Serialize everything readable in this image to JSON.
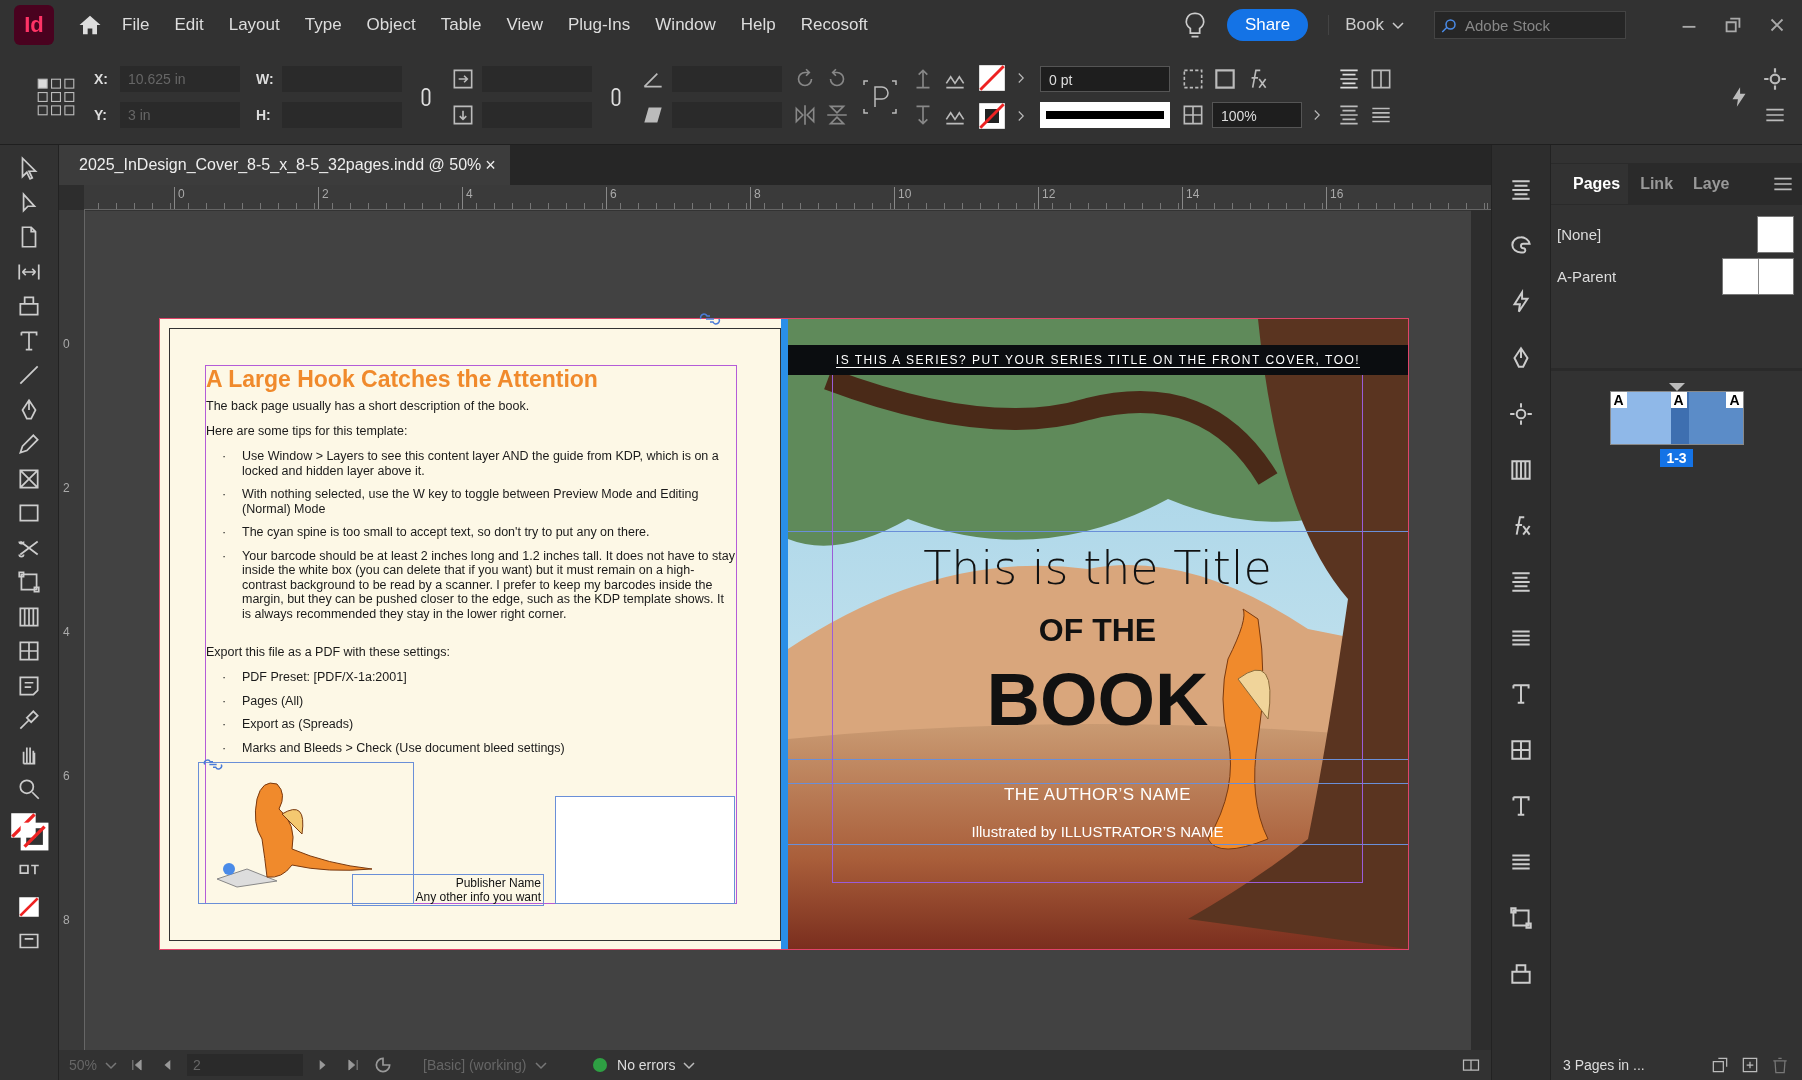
{
  "app": {
    "logo": "Id",
    "menus": [
      "File",
      "Edit",
      "Layout",
      "Type",
      "Object",
      "Table",
      "View",
      "Plug-Ins",
      "Window",
      "Help",
      "Recosoft"
    ],
    "share": "Share",
    "workspace": "Book",
    "stock_search": {
      "placeholder": "Adobe Stock"
    }
  },
  "control_bar": {
    "x_label": "X:",
    "x_value": "10.625 in",
    "y_label": "Y:",
    "y_value": "3 in",
    "w_label": "W:",
    "h_label": "H:",
    "stroke_weight": "0 pt",
    "opacity": "100%"
  },
  "document_tab": {
    "title": "2025_InDesign_Cover_8-5_x_8-5_32pages.indd @ 50%",
    "close": "×"
  },
  "rulers": {
    "horizontal": [
      "0",
      "2",
      "4",
      "6",
      "8",
      "10",
      "12",
      "14",
      "16"
    ],
    "vertical": [
      "0",
      "2",
      "4",
      "6",
      "8"
    ]
  },
  "back_cover": {
    "heading": "A Large Hook Catches the Attention",
    "intro": "The back page usually has a short description of the book.",
    "tips_intro": "Here are some tips for this template:",
    "bullet": "·",
    "tips": [
      "Use Window > Layers to see this content layer AND the guide from KDP, which is on a locked and hidden layer above it.",
      "With nothing selected, use the W key to toggle between Preview Mode and Editing (Normal) Mode",
      "The cyan spine is too small to accept text, so don't try to put any on there.",
      "Your barcode should be at least 2 inches long and 1.2 inches tall. It does not have to stay inside the white box (you can delete that if you want) but it must remain on a high-contrast background to be read by a scanner. I prefer to keep my barcodes inside the margin, but they can be pushed closer to the edge, such as the KDP template shows. It is always recommended they stay in the lower right corner."
    ],
    "export_intro": "Export this file as a PDF with these settings:",
    "export_settings": [
      "PDF Preset: [PDF/X-1a:2001]",
      "Pages (All)",
      "Export as (Spreads)",
      "Marks and Bleeds > Check (Use document bleed settings)"
    ],
    "publisher": [
      "Publisher Name",
      "Any other info you want"
    ]
  },
  "front_cover": {
    "series": "IS THIS A SERIES? PUT YOUR SERIES TITLE ON THE FRONT COVER, TOO!",
    "title_line": "This is the Title",
    "of_the": "OF THE",
    "book": "BOOK",
    "author": "THE AUTHOR’S NAME",
    "illustrator": "Illustrated by ILLUSTRATOR’S NAME"
  },
  "pages_panel": {
    "tabs": [
      {
        "label": "Pages",
        "selected": true
      },
      {
        "label": "Link",
        "selected": false
      },
      {
        "label": "Laye",
        "selected": false
      }
    ],
    "parents": [
      {
        "name": "[None]",
        "kind": "single"
      },
      {
        "name": "A-Parent",
        "kind": "spread"
      }
    ],
    "spread": {
      "prefixes": [
        "A",
        "A",
        "A"
      ],
      "label": "1-3"
    },
    "status": "3 Pages in ..."
  },
  "status_bar": {
    "zoom": "50%",
    "page": "2",
    "style": "[Basic] (working)",
    "preflight": "No errors"
  }
}
